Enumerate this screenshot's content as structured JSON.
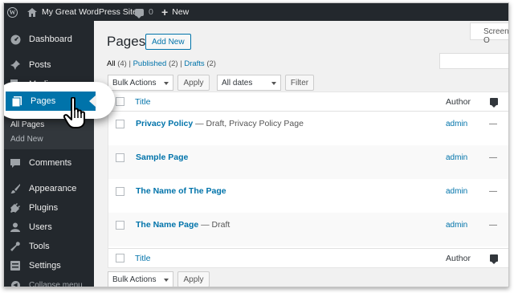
{
  "admin_bar": {
    "site_name": "My Great WordPress Site",
    "comments_count": "0",
    "new_label": "New"
  },
  "sidebar": {
    "items": [
      {
        "label": "Dashboard",
        "icon": "dashboard-icon"
      },
      {
        "label": "Posts",
        "icon": "pin-icon"
      },
      {
        "label": "Media",
        "icon": "media-icon"
      },
      {
        "label": "Pages",
        "icon": "pages-icon",
        "active": true
      },
      {
        "label": "Comments",
        "icon": "comment-icon"
      },
      {
        "label": "Appearance",
        "icon": "brush-icon"
      },
      {
        "label": "Plugins",
        "icon": "plug-icon"
      },
      {
        "label": "Users",
        "icon": "user-icon"
      },
      {
        "label": "Tools",
        "icon": "wrench-icon"
      },
      {
        "label": "Settings",
        "icon": "settings-icon"
      }
    ],
    "submenu": [
      "All Pages",
      "Add New"
    ],
    "collapse_label": "Collapse menu"
  },
  "main": {
    "screen_options": "Screen O",
    "title": "Pages",
    "add_new": "Add New",
    "filters": [
      {
        "label": "All",
        "count": "(4)"
      },
      {
        "label": "Published",
        "count": "(2)"
      },
      {
        "label": "Drafts",
        "count": "(2)"
      }
    ],
    "bulk_actions": "Bulk Actions",
    "apply": "Apply",
    "dates": "All dates",
    "filter": "Filter",
    "columns": {
      "title": "Title",
      "author": "Author"
    },
    "rows": [
      {
        "title": "Privacy Policy",
        "state": " — Draft, Privacy Policy Page",
        "author": "admin",
        "comments": "—"
      },
      {
        "title": "Sample Page",
        "state": "",
        "author": "admin",
        "comments": "—"
      },
      {
        "title": "The Name of The Page",
        "state": "",
        "author": "admin",
        "comments": "—"
      },
      {
        "title": "The Name Page",
        "state": " — Draft",
        "author": "admin",
        "comments": "—"
      }
    ]
  },
  "colors": {
    "admin_dark": "#23282d",
    "accent": "#0073aa",
    "background": "#f1f1f1"
  }
}
